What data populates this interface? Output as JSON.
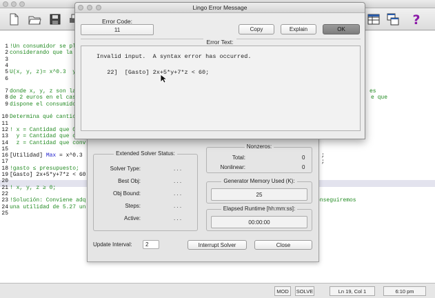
{
  "app": {
    "editor_lines": [
      {
        "num": "1",
        "text": "!Un consumidor se pl",
        "style": "comment"
      },
      {
        "num": "2",
        "text": "considerando que la",
        "style": "comment"
      },
      {
        "num": "3",
        "text": "",
        "style": "comment"
      },
      {
        "num": "4",
        "text": "",
        "style": "comment"
      },
      {
        "num": "5",
        "text": "U(x, y, z)= x^0.3  y",
        "style": "comment"
      },
      {
        "num": "6",
        "text": "",
        "style": "comment"
      },
      {
        "num": "",
        "text": "",
        "style": "comment"
      },
      {
        "num": "7",
        "text": "donde x, y, z son la",
        "style": "comment"
      },
      {
        "num": "8",
        "text": "de 2 euros en el cas",
        "style": "comment"
      },
      {
        "num": "9",
        "text": "dispone el consumido",
        "style": "comment"
      },
      {
        "num": "",
        "text": "",
        "style": "comment"
      },
      {
        "num": "10",
        "text": "Determina qué cantic",
        "style": "comment"
      },
      {
        "num": "11",
        "text": "",
        "style": "comment"
      },
      {
        "num": "12",
        "text": "! x = Cantidad que C",
        "style": "comment"
      },
      {
        "num": "13",
        "text": "  y = Cantidad que conv",
        "style": "comment"
      },
      {
        "num": "14",
        "text": "  z = Cantidad que conv",
        "style": "comment"
      },
      {
        "num": "15",
        "text": "",
        "style": "comment"
      },
      {
        "num": "16",
        "text": "[Utilidad] Max = x^0.3",
        "style": "code"
      },
      {
        "num": "17",
        "text": "",
        "style": "comment"
      },
      {
        "num": "18",
        "text": "!gasto ≤ presupuesto;",
        "style": "comment"
      },
      {
        "num": "19",
        "text": "[Gasto] 2x+5*y+7*z < 60",
        "style": "code"
      },
      {
        "num": "20",
        "text": "",
        "style": "comment"
      },
      {
        "num": "21",
        "text": "! x, y, z ≥ 0;",
        "style": "comment"
      },
      {
        "num": "22",
        "text": "",
        "style": "comment"
      },
      {
        "num": "23",
        "text": "!Solución: Conviene adq",
        "style": "comment"
      },
      {
        "num": "24",
        "text": "una utilidad de 5.27 un",
        "style": "comment"
      },
      {
        "num": "25",
        "text": "",
        "style": "comment"
      }
    ],
    "right_fragments": [
      {
        "line": 7,
        "text": "es"
      },
      {
        "line": 8,
        "text": "e que"
      },
      {
        "line": 16,
        "text": ";"
      },
      {
        "line": 17,
        "text": ";"
      },
      {
        "line": 23,
        "text": "onseguiremos"
      }
    ],
    "status": {
      "mode": "MOD",
      "solve": "SOLVE",
      "position": "Ln 19, Col 1",
      "time": "6:10 pm"
    }
  },
  "solver_status": {
    "extended_title": "Extended Solver Status:",
    "rows": [
      {
        "label": "Solver Type:",
        "value": ". . ."
      },
      {
        "label": "Best Obj:",
        "value": ". . ."
      },
      {
        "label": "Obj Bound:",
        "value": ". . ."
      },
      {
        "label": "Steps:",
        "value": ". . ."
      },
      {
        "label": "Active:",
        "value": ". . ."
      }
    ],
    "nonzeros_title": "Nonzeros:",
    "nonzeros_total_label": "Total:",
    "nonzeros_total_value": "0",
    "nonzeros_nonlinear_label": "Nonlinear:",
    "nonzeros_nonlinear_value": "0",
    "memory_title": "Generator Memory Used (K):",
    "memory_value": "25",
    "runtime_title": "Elapsed Runtime [hh:mm:ss]:",
    "runtime_value": "00:00:00",
    "update_interval_label": "Update Interval:",
    "update_interval_value": "2",
    "interrupt_label": "Interrupt Solver",
    "close_label": "Close"
  },
  "dialog": {
    "title": "Lingo Error Message",
    "error_code_label": "Error Code:",
    "error_code_value": "11",
    "copy_label": "Copy",
    "explain_label": "Explain",
    "ok_label": "OK",
    "error_text_label": "Error Text:",
    "error_message": "Invalid input.  A syntax error has occurred.",
    "error_line": "   22]  [Gasto] 2x+5*y+7*z < 60;"
  },
  "colors": {
    "comment": "#228b22",
    "keyword": "#1a1acc",
    "ok_button": "#8a8a8a",
    "help_icon": "#8b1aa8"
  },
  "toolbar_icons": [
    "new-file-icon",
    "open-file-icon",
    "save-icon",
    "window-grid-icon",
    "window-cascade-icon",
    "help-icon"
  ]
}
